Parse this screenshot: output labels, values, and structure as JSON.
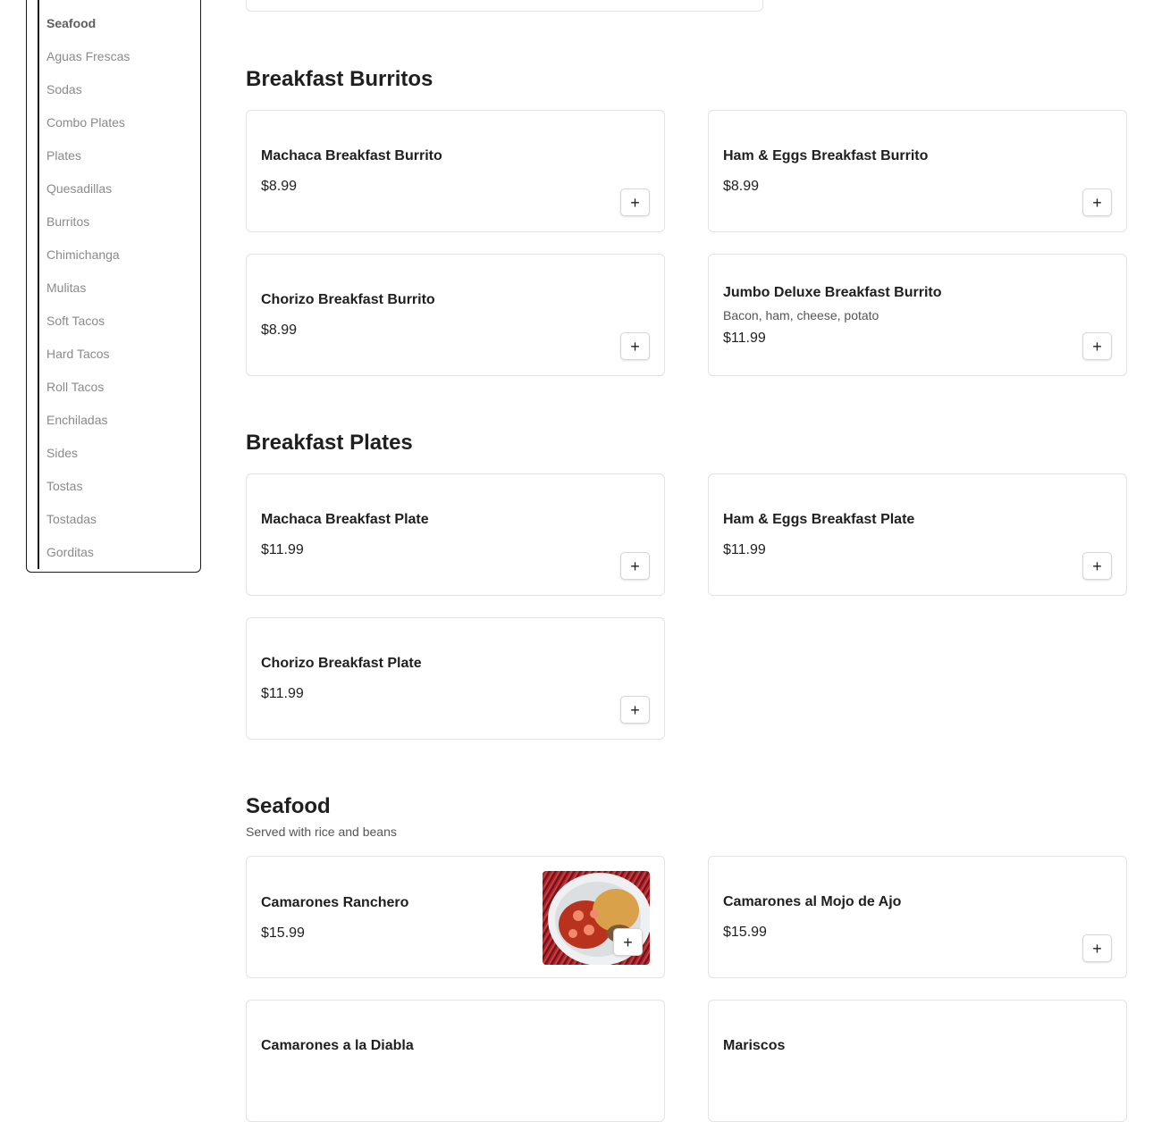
{
  "sidebar": {
    "items": [
      {
        "label": "Seafood",
        "active": true
      },
      {
        "label": "Aguas Frescas"
      },
      {
        "label": "Sodas"
      },
      {
        "label": "Combo Plates"
      },
      {
        "label": "Plates"
      },
      {
        "label": "Quesadillas"
      },
      {
        "label": "Burritos"
      },
      {
        "label": "Chimichanga"
      },
      {
        "label": "Mulitas"
      },
      {
        "label": "Soft Tacos"
      },
      {
        "label": "Hard Tacos"
      },
      {
        "label": "Roll Tacos"
      },
      {
        "label": "Enchiladas"
      },
      {
        "label": "Sides"
      },
      {
        "label": "Tostas"
      },
      {
        "label": "Tostadas"
      },
      {
        "label": "Gorditas"
      }
    ]
  },
  "sections": [
    {
      "title": "Breakfast Burritos",
      "items": [
        {
          "name": "Machaca Breakfast Burrito",
          "price": "$8.99"
        },
        {
          "name": "Ham & Eggs Breakfast Burrito",
          "price": "$8.99"
        },
        {
          "name": "Chorizo Breakfast Burrito",
          "price": "$8.99"
        },
        {
          "name": "Jumbo Deluxe Breakfast Burrito",
          "description": "Bacon, ham, cheese, potato",
          "price": "$11.99"
        }
      ]
    },
    {
      "title": "Breakfast Plates",
      "items": [
        {
          "name": "Machaca Breakfast Plate",
          "price": "$11.99"
        },
        {
          "name": "Ham & Eggs Breakfast Plate",
          "price": "$11.99"
        },
        {
          "name": "Chorizo Breakfast Plate",
          "price": "$11.99"
        }
      ]
    },
    {
      "title": "Seafood",
      "subtitle": "Served with rice and beans",
      "items": [
        {
          "name": "Camarones Ranchero",
          "price": "$15.99",
          "image": "shrimp-dish-photo"
        },
        {
          "name": "Camarones al Mojo de Ajo",
          "price": "$15.99"
        },
        {
          "name": "Camarones a la Diabla",
          "price": ""
        },
        {
          "name": "Mariscos",
          "price": ""
        }
      ]
    }
  ],
  "add_button_symbol": "+",
  "colors": {
    "border": "#e3e3e3",
    "text": "#1f1f1f",
    "muted": "#8a8a8a"
  }
}
